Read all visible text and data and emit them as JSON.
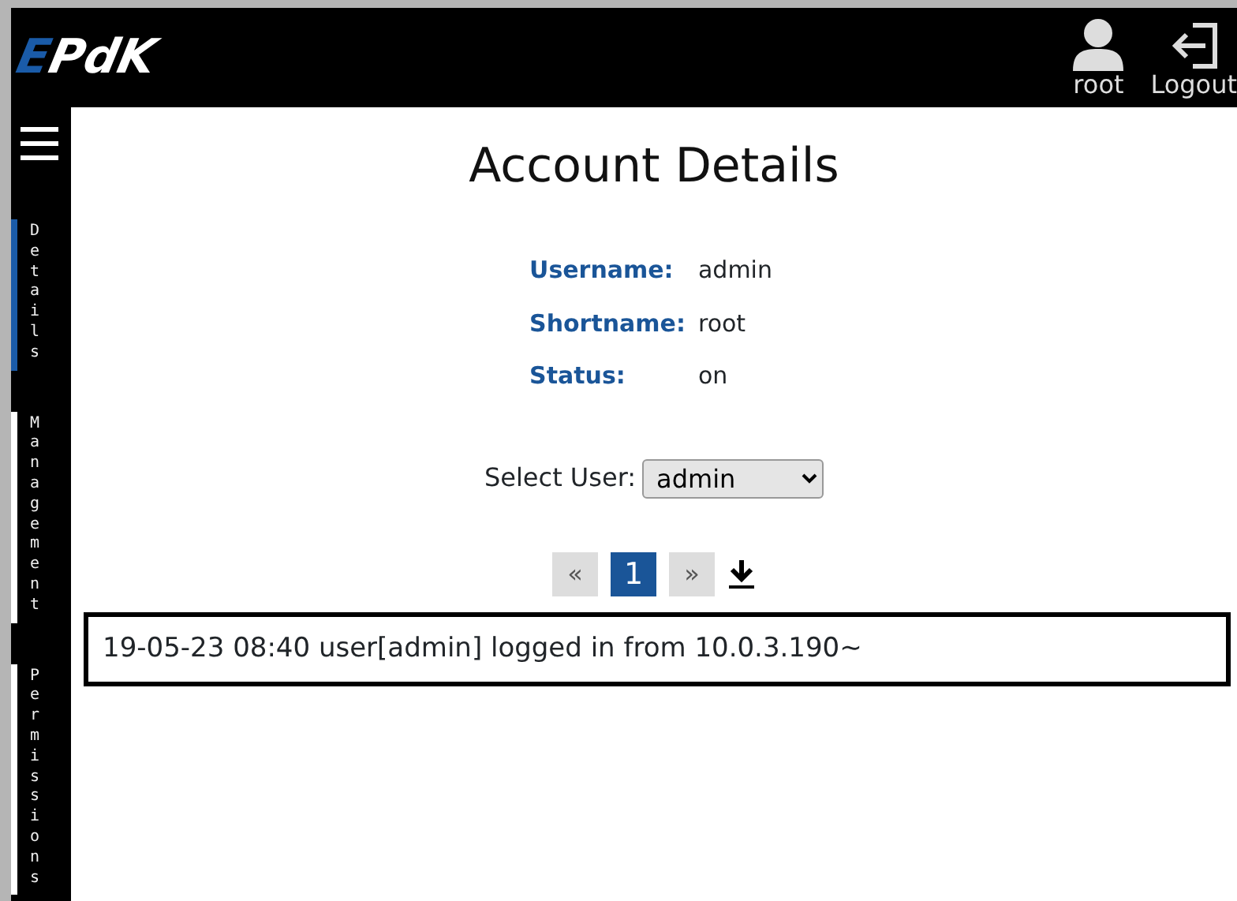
{
  "header": {
    "logo": "EPdK",
    "user": "root",
    "logout": "Logout"
  },
  "sidebar": {
    "tabs": [
      {
        "label": "Details",
        "selected": true
      },
      {
        "label": "Management",
        "selected": false
      },
      {
        "label": "Permissions",
        "selected": false
      }
    ]
  },
  "title": "Account Details",
  "details": [
    {
      "label": "Username:",
      "value": "admin"
    },
    {
      "label": "Shortname:",
      "value": "root"
    },
    {
      "label": "Status:",
      "value": "on"
    }
  ],
  "select_user": {
    "label": "Select User:",
    "value": "admin"
  },
  "pagination": {
    "prev": "«",
    "pages": [
      {
        "label": "1",
        "selected": true
      }
    ],
    "next": "»"
  },
  "log": [
    "19-05-23 08:40 user[admin] logged in from 10.0.3.190~"
  ]
}
